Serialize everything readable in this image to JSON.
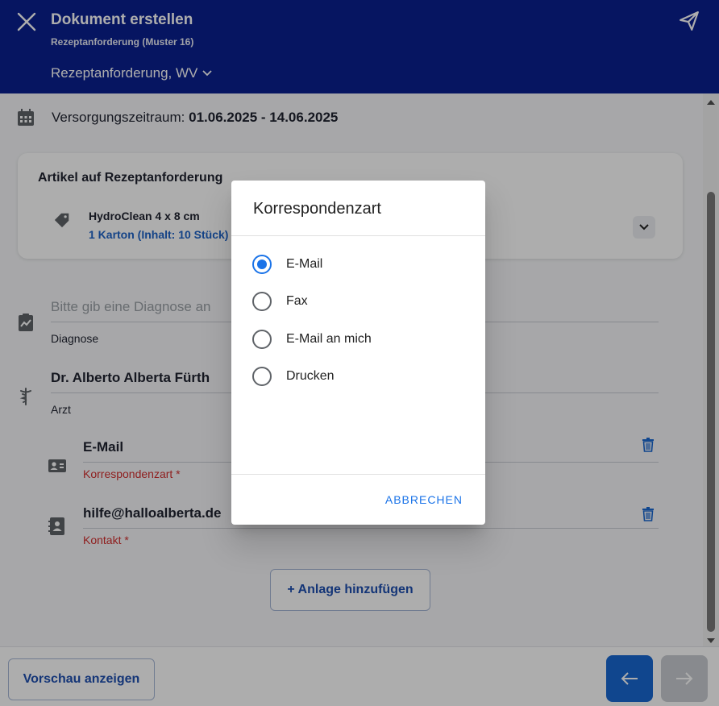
{
  "header": {
    "title": "Dokument erstellen",
    "subtitle": "Rezeptanforderung (Muster 16)",
    "doc_type": "Rezeptanforderung, WV"
  },
  "period": {
    "label": "Versorgungszeitraum:",
    "value": "01.06.2025 - 14.06.2025"
  },
  "articles": {
    "title": "Artikel auf Rezeptanforderung",
    "item_name": "HydroClean 4 x 8 cm",
    "item_qty": "1 Karton (Inhalt: 10 Stück)"
  },
  "diagnosis": {
    "placeholder": "Bitte gib eine Diagnose an",
    "label": "Diagnose"
  },
  "doctor": {
    "value": "Dr. Alberto Alberta Fürth",
    "label": "Arzt"
  },
  "correspondence": {
    "value": "E-Mail",
    "label": "Korrespondenzart *"
  },
  "contact": {
    "value": "hilfe@halloalberta.de",
    "label": "Kontakt *"
  },
  "add_attachment": "+ Anlage hinzufügen",
  "footer": {
    "preview": "Vorschau anzeigen"
  },
  "dialog": {
    "title": "Korrespondenzart",
    "options": [
      "E-Mail",
      "Fax",
      "E-Mail an mich",
      "Drucken"
    ],
    "selected": "E-Mail",
    "cancel": "ABBRECHEN"
  },
  "colors": {
    "header_bg": "#0a1f8f",
    "accent": "#1a73e8",
    "error": "#d32f2f"
  }
}
